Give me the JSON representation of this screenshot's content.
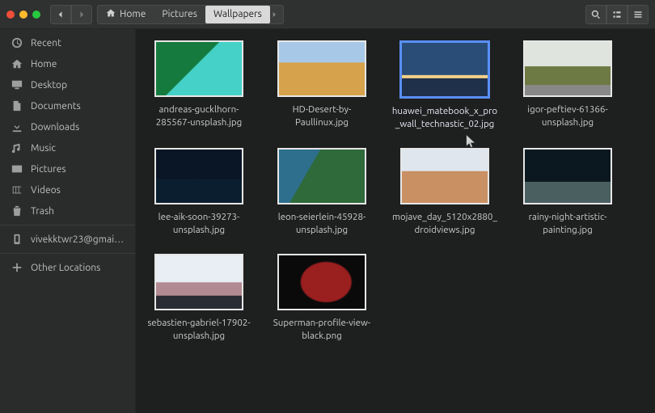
{
  "breadcrumbs": {
    "items": [
      {
        "label": "Home",
        "icon": "home",
        "current": false
      },
      {
        "label": "Pictures",
        "icon": null,
        "current": false
      },
      {
        "label": "Wallpapers",
        "icon": null,
        "current": true
      }
    ]
  },
  "sidebar": {
    "items": [
      {
        "icon": "recent",
        "label": "Recent"
      },
      {
        "icon": "home",
        "label": "Home"
      },
      {
        "icon": "desktop",
        "label": "Desktop"
      },
      {
        "icon": "documents",
        "label": "Documents"
      },
      {
        "icon": "downloads",
        "label": "Downloads"
      },
      {
        "icon": "music",
        "label": "Music"
      },
      {
        "icon": "pictures",
        "label": "Pictures"
      },
      {
        "icon": "videos",
        "label": "Videos"
      },
      {
        "icon": "trash",
        "label": "Trash"
      }
    ],
    "account": {
      "icon": "phone",
      "label": "vivekktwr23@gmail…."
    },
    "other": {
      "icon": "plus",
      "label": "Other Locations"
    }
  },
  "files": [
    {
      "name": "andreas-gucklhorn-285567-unsplash.jpg",
      "thumb": "t-andreas",
      "selected": false
    },
    {
      "name": "HD-Desert-by-Paullinux.jpg",
      "thumb": "t-desert",
      "selected": false
    },
    {
      "name": "huawei_matebook_x_pro_wall_technastic_02.jpg",
      "thumb": "t-huawei",
      "selected": true
    },
    {
      "name": "igor-peftiev-61366-unsplash.jpg",
      "thumb": "t-igor",
      "selected": false
    },
    {
      "name": "lee-aik-soon-39273-unsplash.jpg",
      "thumb": "t-lee",
      "selected": false
    },
    {
      "name": "leon-seierlein-45928-unsplash.jpg",
      "thumb": "t-leon",
      "selected": false
    },
    {
      "name": "mojave_day_5120x2880_droidviews.jpg",
      "thumb": "t-mojave",
      "selected": false
    },
    {
      "name": "rainy-night-artistic-painting.jpg",
      "thumb": "t-rainy",
      "selected": false
    },
    {
      "name": "sebastien-gabriel-17902-unsplash.jpg",
      "thumb": "t-seb",
      "selected": false
    },
    {
      "name": "Superman-profile-view-black.png",
      "thumb": "t-sup",
      "selected": false
    }
  ]
}
